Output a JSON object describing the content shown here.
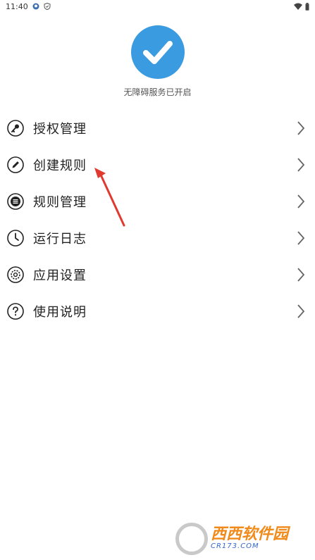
{
  "status_bar": {
    "time": "11:40"
  },
  "hero": {
    "service_status": "无障碍服务已开启"
  },
  "menu": {
    "items": [
      {
        "label": "授权管理",
        "icon": "key-icon"
      },
      {
        "label": "创建规则",
        "icon": "pencil-icon"
      },
      {
        "label": "规则管理",
        "icon": "list-icon"
      },
      {
        "label": "运行日志",
        "icon": "clock-icon"
      },
      {
        "label": "应用设置",
        "icon": "gear-icon"
      },
      {
        "label": "使用说明",
        "icon": "help-icon"
      }
    ]
  },
  "watermark": {
    "brand": "西西软件园",
    "site": "CR173.COM"
  },
  "colors": {
    "accent": "#3b9be0",
    "annotation_arrow": "#e03a2f"
  }
}
